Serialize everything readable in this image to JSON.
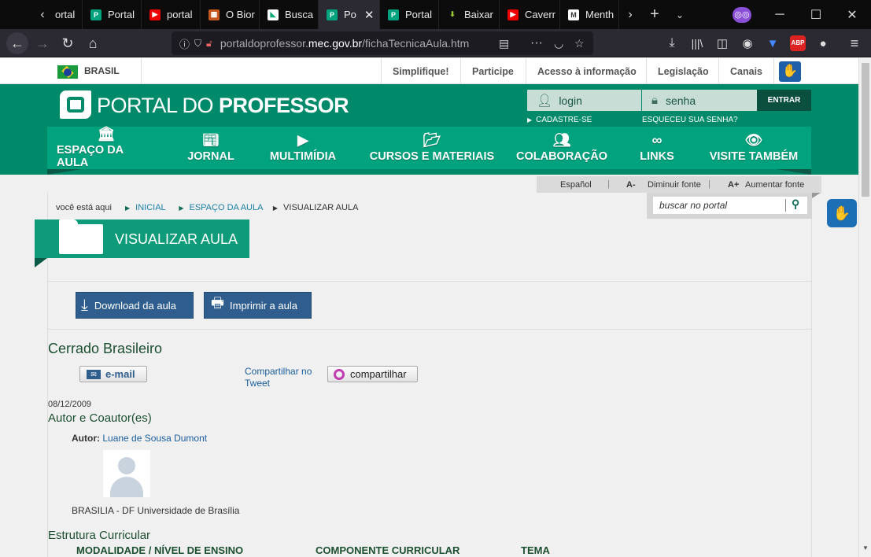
{
  "browser": {
    "tabs": [
      {
        "label": "ortal",
        "icon": "portal-icon"
      },
      {
        "label": "Portal",
        "icon": "portal-icon"
      },
      {
        "label": "portal",
        "icon": "youtube-icon"
      },
      {
        "label": "O Bior",
        "icon": "biome-icon"
      },
      {
        "label": "Busca",
        "icon": "busca-icon"
      },
      {
        "label": "Po",
        "icon": "portal-icon",
        "active": true
      },
      {
        "label": "Portal",
        "icon": "portal-icon"
      },
      {
        "label": "Baixar",
        "icon": "download-icon"
      },
      {
        "label": "Caverr",
        "icon": "youtube-icon"
      },
      {
        "label": "Menth",
        "icon": "m-icon"
      }
    ],
    "url_domain": "portaldoprofessor.",
    "url_host": "mec.gov.br",
    "url_path": "/fichaTecnicaAula.htm",
    "abp_label": "ABP"
  },
  "topstrip": {
    "country": "BRASIL",
    "links": [
      "Simplifique!",
      "Participe",
      "Acesso à informação",
      "Legislação",
      "Canais"
    ]
  },
  "header": {
    "logo_part1": "PORTAL DO ",
    "logo_part2": "PROFESSOR",
    "login_placeholder": "login",
    "password_placeholder": "senha",
    "enter_label": "ENTRAR",
    "register_label": "CADASTRE-SE",
    "forgot_label": "ESQUECEU SUA SENHA?",
    "nav": [
      {
        "label": "ESPAÇO DA AULA",
        "icon": "building-icon"
      },
      {
        "label": "JORNAL",
        "icon": "newspaper-icon"
      },
      {
        "label": "MULTIMÍDIA",
        "icon": "play-icon"
      },
      {
        "label": "CURSOS E MATERIAIS",
        "icon": "folder-icon"
      },
      {
        "label": "COLABORAÇÃO",
        "icon": "people-icon"
      },
      {
        "label": "LINKS",
        "icon": "link-icon"
      },
      {
        "label": "VISITE TAMBÉM",
        "icon": "eye-icon"
      }
    ]
  },
  "utility": {
    "spanish": "Español",
    "decrease": "Diminuir fonte",
    "decrease_glyph": "A-",
    "increase": "Aumentar fonte",
    "increase_glyph": "A+",
    "search_placeholder": "buscar no portal"
  },
  "breadcrumb": {
    "prefix": "você está aqui",
    "items": [
      "INICIAL",
      "ESPAÇO DA AULA",
      "VISUALIZAR AULA"
    ]
  },
  "section_title": "VISUALIZAR AULA",
  "actions": {
    "download": "Download da aula",
    "print": "Imprimir a aula"
  },
  "lesson": {
    "title": "Cerrado Brasileiro",
    "email_label": "e-mail",
    "share_text": "Compartilhar no",
    "tweet_text": "Tweet",
    "share_button": "compartilhar",
    "date": "08/12/2009",
    "authors_heading": "Autor e Coautor(es)",
    "author_label": "Autor:",
    "author_name": "Luane de Sousa Dumont",
    "author_affiliation": "BRASILIA - DF Universidade de Brasília",
    "structure_heading": "Estrutura Curricular",
    "columns": [
      "MODALIDADE / NÍVEL DE ENSINO",
      "COMPONENTE CURRICULAR",
      "TEMA"
    ]
  },
  "colors": {
    "brand_green": "#008a6a",
    "nav_green": "#00a37e",
    "button_blue": "#2f5e8e"
  }
}
